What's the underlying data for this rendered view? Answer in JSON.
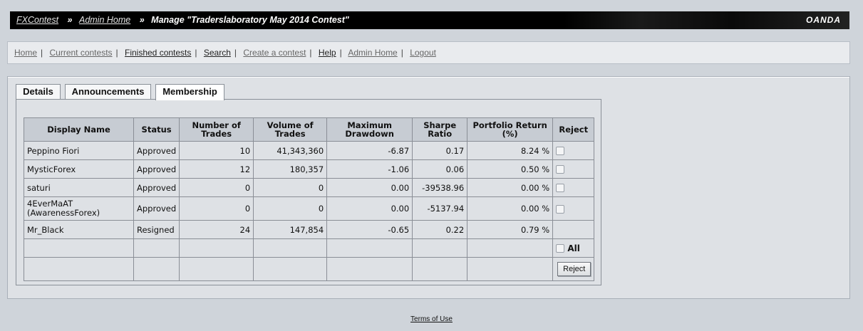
{
  "header": {
    "crumbs": [
      "FXContest",
      "Admin Home"
    ],
    "separator": "»",
    "title": "Manage \"Traderslaboratory May 2014 Contest\"",
    "brand": "OANDA"
  },
  "nav": {
    "items": [
      "Home",
      "Current contests",
      "Finished contests",
      "Search",
      "Create a contest",
      "Help",
      "Admin Home",
      "Logout"
    ],
    "pipe": "|"
  },
  "tabs": [
    "Details",
    "Announcements",
    "Membership"
  ],
  "active_tab": "Membership",
  "table": {
    "headers": [
      "Display Name",
      "Status",
      "Number of Trades",
      "Volume of Trades",
      "Maximum Drawdown",
      "Sharpe Ratio",
      "Portfolio Return (%)",
      "Reject"
    ],
    "rows": [
      {
        "name": "Peppino Fiori",
        "status": "Approved",
        "trades": "10",
        "volume": "41,343,360",
        "drawdown": "-6.87",
        "sharpe": "0.17",
        "return": "8.24 %"
      },
      {
        "name": "MysticForex",
        "status": "Approved",
        "trades": "12",
        "volume": "180,357",
        "drawdown": "-1.06",
        "sharpe": "0.06",
        "return": "0.50 %"
      },
      {
        "name": "saturi",
        "status": "Approved",
        "trades": "0",
        "volume": "0",
        "drawdown": "0.00",
        "sharpe": "-39538.96",
        "return": "0.00 %"
      },
      {
        "name": "4EverMaAT (AwarenessForex)",
        "status": "Approved",
        "trades": "0",
        "volume": "0",
        "drawdown": "0.00",
        "sharpe": "-5137.94",
        "return": "0.00 %"
      },
      {
        "name": "Mr_Black",
        "status": "Resigned",
        "trades": "24",
        "volume": "147,854",
        "drawdown": "-0.65",
        "sharpe": "0.22",
        "return": "0.79 %"
      }
    ],
    "all_label": "All",
    "reject_button": "Reject"
  },
  "footer": {
    "terms": "Terms of Use"
  }
}
